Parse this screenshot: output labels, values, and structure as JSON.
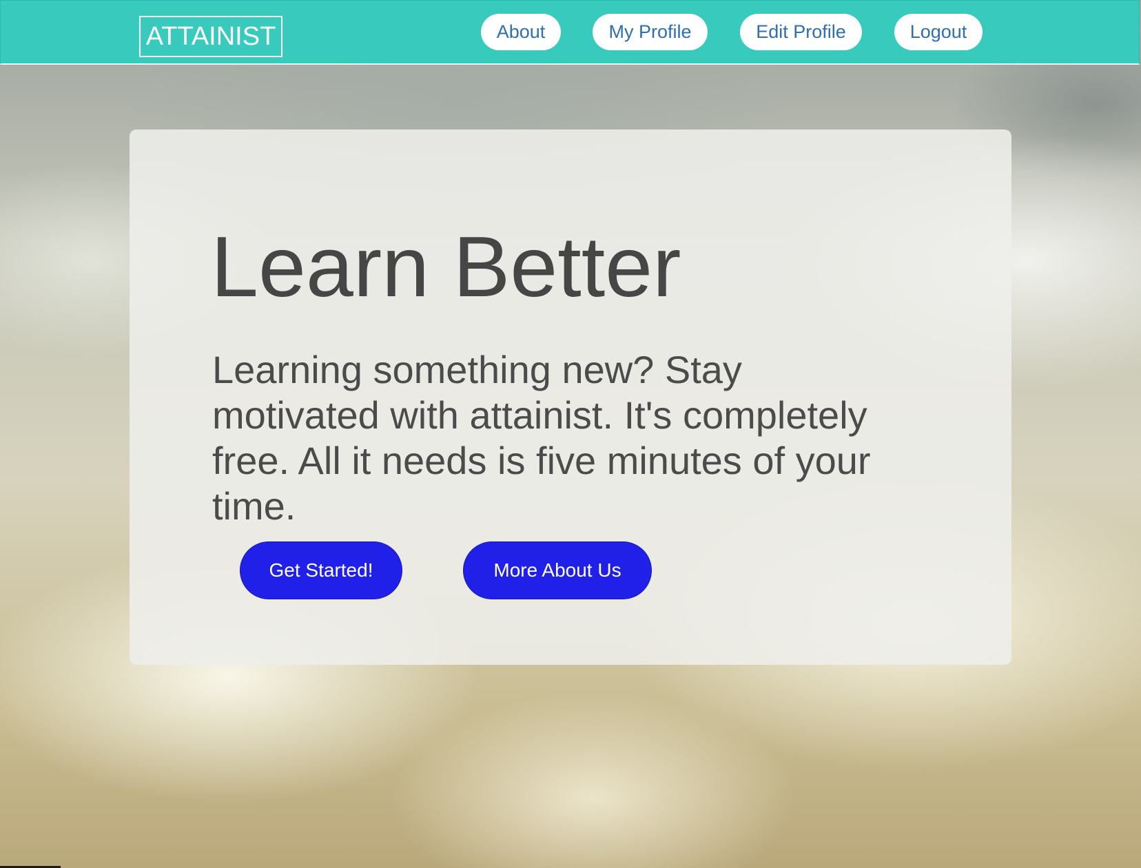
{
  "navbar": {
    "brand": "ATTAINIST",
    "links": [
      {
        "label": "About"
      },
      {
        "label": "My Profile"
      },
      {
        "label": "Edit Profile"
      },
      {
        "label": "Logout"
      }
    ]
  },
  "hero": {
    "title": "Learn Better",
    "subtitle": "Learning something new? Stay motivated with attainist. It's completely free. All it needs is five minutes of your time.",
    "primary_button": "Get Started!",
    "secondary_button": "More About Us"
  },
  "colors": {
    "navbar": "#37cabd",
    "nav_link_text": "#2d6fb0",
    "button": "#2020e8",
    "hero_text": "#464646"
  }
}
